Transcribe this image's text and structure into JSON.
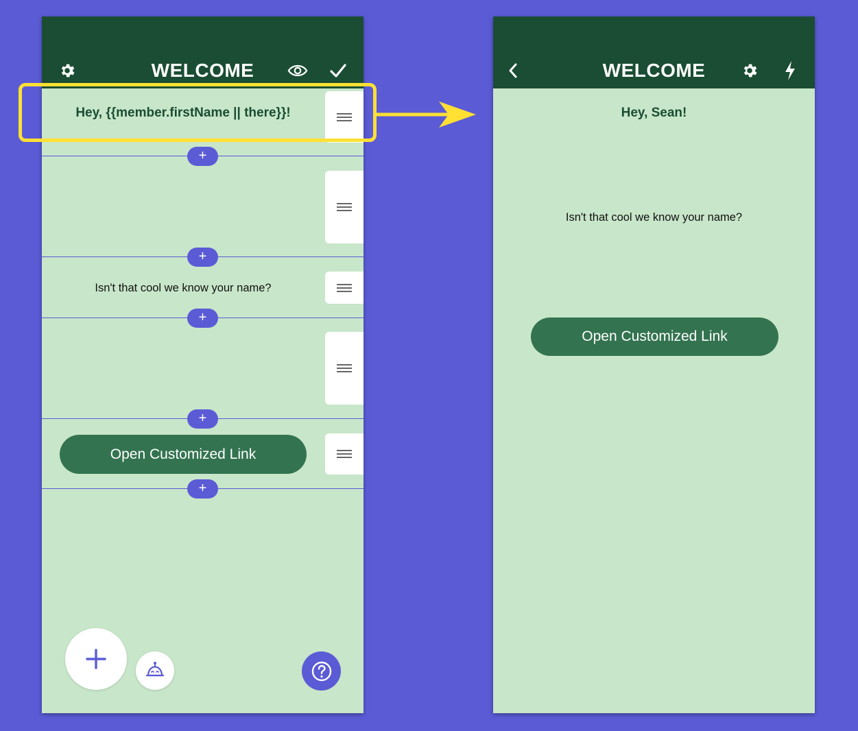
{
  "colors": {
    "background": "#5b5bd6",
    "header": "#1a4d33",
    "screen": "#c8e6c9",
    "button": "#337350",
    "accent": "#5b5bd6",
    "highlight": "#ffe033"
  },
  "editor": {
    "header": {
      "title": "WELCOME",
      "left_icon": "gear-icon",
      "right_icons": [
        "eye-icon",
        "check-icon"
      ]
    },
    "blocks": [
      {
        "type": "text",
        "text": "Hey, {{member.firstName || there}}!"
      },
      {
        "type": "spacer",
        "text": ""
      },
      {
        "type": "text",
        "text": "Isn't that cool we know your name?"
      },
      {
        "type": "spacer",
        "text": ""
      },
      {
        "type": "button",
        "text": "Open Customized Link"
      }
    ],
    "add_label": "+",
    "fab_icon": "plus-icon",
    "robot_icon": "robot-icon",
    "help_icon": "question-icon"
  },
  "preview": {
    "header": {
      "title": "WELCOME",
      "left_icon": "chevron-left-icon",
      "right_icons": [
        "gear-icon",
        "lightning-icon"
      ]
    },
    "greeting": "Hey, Sean!",
    "message": "Isn't that cool we know your name?",
    "button_label": "Open Customized Link"
  }
}
